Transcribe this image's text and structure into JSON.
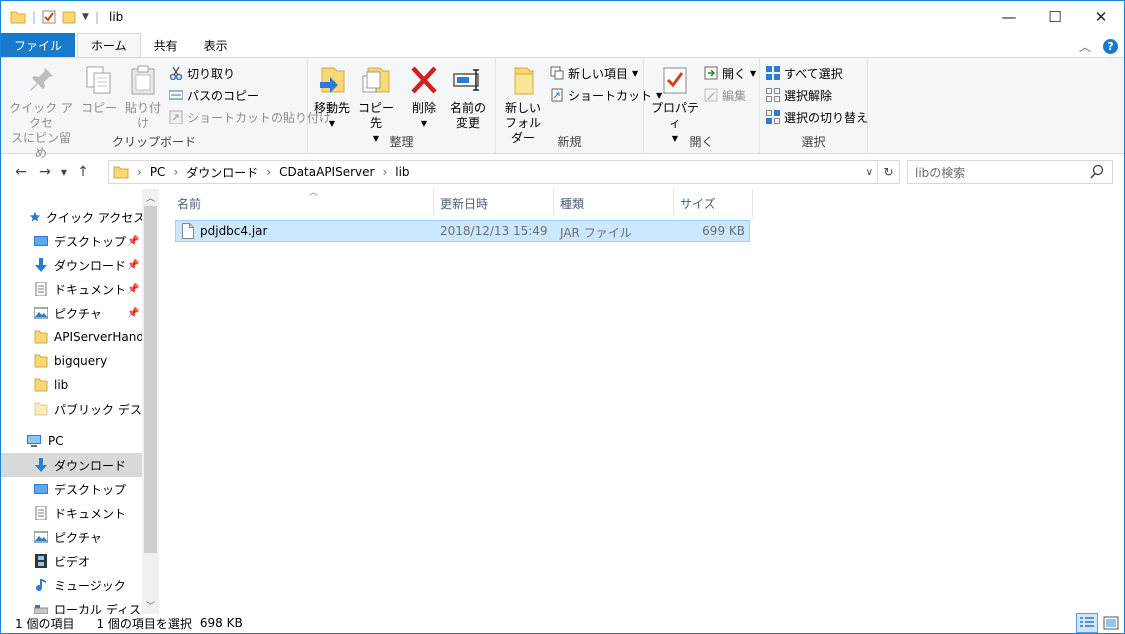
{
  "window": {
    "title": "lib"
  },
  "tabs": [
    {
      "label": "ファイル"
    },
    {
      "label": "ホーム"
    },
    {
      "label": "共有"
    },
    {
      "label": "表示"
    }
  ],
  "ribbon": {
    "clipboard": {
      "label": "クリップボード",
      "pin_line1": "クイック アクセ",
      "pin_line2": "スにピン留め",
      "copy": "コピー",
      "paste": "貼り付け",
      "cut": "切り取り",
      "copy_path": "パスのコピー",
      "paste_shortcut": "ショートカットの貼り付け"
    },
    "organize": {
      "label": "整理",
      "move_to": "移動先",
      "copy_to": "コピー先",
      "delete": "削除",
      "rename_line1": "名前の",
      "rename_line2": "変更"
    },
    "new": {
      "label": "新規",
      "new_folder_line1": "新しい",
      "new_folder_line2": "フォルダー",
      "new_item": "新しい項目",
      "shortcut": "ショートカット"
    },
    "open": {
      "label": "開く",
      "properties": "プロパティ",
      "open": "開く",
      "edit": "編集"
    },
    "select": {
      "label": "選択",
      "select_all": "すべて選択",
      "select_none": "選択解除",
      "invert": "選択の切り替え"
    }
  },
  "address": {
    "crumbs": [
      "PC",
      "ダウンロード",
      "CDataAPIServer",
      "lib"
    ],
    "search_placeholder": "libの検索"
  },
  "nav": {
    "quick_access": "クイック アクセス",
    "items": [
      {
        "label": "デスクトップ"
      },
      {
        "label": "ダウンロード"
      },
      {
        "label": "ドキュメント"
      },
      {
        "label": "ピクチャ"
      },
      {
        "label": "APIServerHands"
      },
      {
        "label": "bigquery"
      },
      {
        "label": "lib"
      },
      {
        "label": "パブリック デスクトッ"
      }
    ],
    "pc": "PC",
    "pc_items": [
      {
        "label": "ダウンロード"
      },
      {
        "label": "デスクトップ"
      },
      {
        "label": "ドキュメント"
      },
      {
        "label": "ピクチャ"
      },
      {
        "label": "ビデオ"
      },
      {
        "label": "ミュージック"
      },
      {
        "label": "ローカル ディスク (C"
      }
    ]
  },
  "columns": {
    "name": "名前",
    "date": "更新日時",
    "type": "種類",
    "size": "サイズ"
  },
  "files": [
    {
      "name": "pdjdbc4.jar",
      "date": "2018/12/13 15:49",
      "type": "JAR ファイル",
      "size": "699 KB"
    }
  ],
  "status": {
    "count": "1 個の項目",
    "selected": "1 個の項目を選択",
    "size": "698 KB"
  },
  "colors": {
    "accent": "#1979ca",
    "selection": "#cce8ff",
    "folder": "#f8d775"
  }
}
